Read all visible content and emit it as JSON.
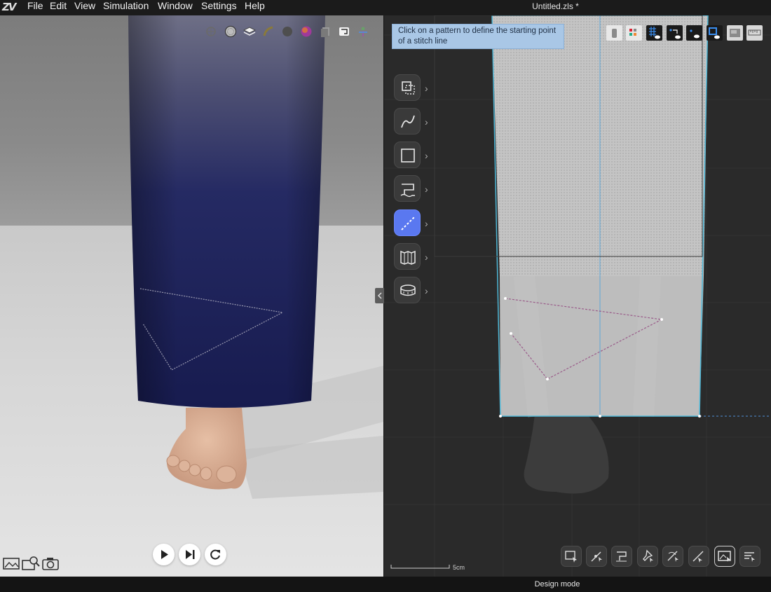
{
  "app": {
    "logo_text": "ZV",
    "window_title": "Untitled.zls *"
  },
  "menu": [
    "File",
    "Edit",
    "View",
    "Simulation",
    "Window",
    "Settings",
    "Help"
  ],
  "viewport3d": {
    "top_toolbar_icons": [
      "axis-icon",
      "texture-sphere-icon",
      "layers-icon",
      "ruler-icon",
      "dark-sphere-icon",
      "color-sphere-icon",
      "copy-icon",
      "sewing-icon",
      "avatar-icon"
    ],
    "bottom_left_icons": [
      "screenshot-icon",
      "zoom-scene-icon",
      "camera-icon"
    ],
    "playback": [
      "play-icon",
      "step-forward-icon",
      "reset-icon"
    ]
  },
  "viewport2d": {
    "tooltip": "Click on a pattern to define the starting point of a stitch line",
    "tools": [
      {
        "name": "transform-pattern-icon",
        "active": false
      },
      {
        "name": "curve-icon",
        "active": false
      },
      {
        "name": "rectangle-icon",
        "active": false
      },
      {
        "name": "sewing-machine-icon",
        "active": false
      },
      {
        "name": "stitch-line-icon",
        "active": true
      },
      {
        "name": "fold-icon",
        "active": false
      },
      {
        "name": "tape-measure-icon",
        "active": false
      }
    ],
    "top_right_icons": [
      "avatar-silhouette-icon",
      "color-grid-icon",
      "grid-eye-icon",
      "points-eye-icon",
      "dot-eye-icon",
      "pattern-eye-icon",
      "texture-icon",
      "ruler-bar-icon"
    ],
    "bottom_tools": [
      "select-icon",
      "edit-point-icon",
      "pattern-edit-icon",
      "pin-icon",
      "stitch-edit-icon",
      "add-point-icon",
      "image-edit-icon",
      "list-edit-icon"
    ],
    "scale_label": "5cm"
  },
  "status": {
    "mode": "Design mode"
  },
  "colors": {
    "accent": "#5a78f0",
    "tooltip_bg": "#a9c7e6",
    "denim": "#1b1f4d",
    "outline": "#4fb7d6",
    "stitch": "#9a5c8a"
  }
}
